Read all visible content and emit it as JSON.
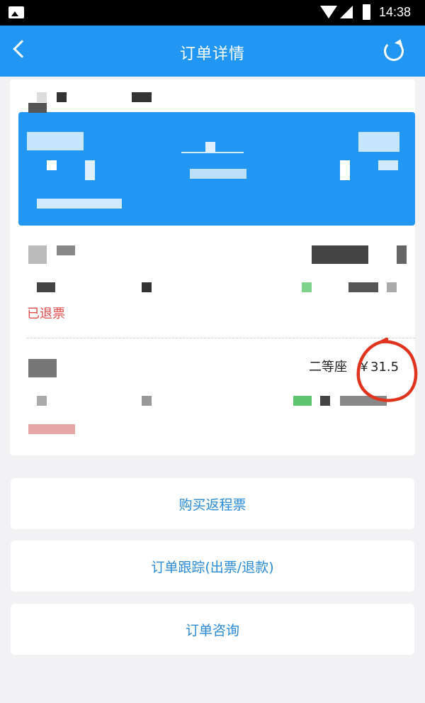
{
  "status_bar": {
    "time": "14:38"
  },
  "nav": {
    "title": "订单详情",
    "back_icon": "back-arrow-icon",
    "refresh_icon": "refresh-icon"
  },
  "tickets": [
    {
      "status": "已退票"
    },
    {
      "seat_class": "二等座",
      "price": "￥31.5"
    }
  ],
  "actions": {
    "buy_return": "购买返程票",
    "track_order": "订单跟踪(出票/退款)",
    "consult_order": "订单咨询"
  },
  "colors": {
    "header_blue": "#2196f3",
    "refund_red": "#e24c4c",
    "button_text": "#2a8ad8",
    "annotation_red": "#e0341f"
  }
}
